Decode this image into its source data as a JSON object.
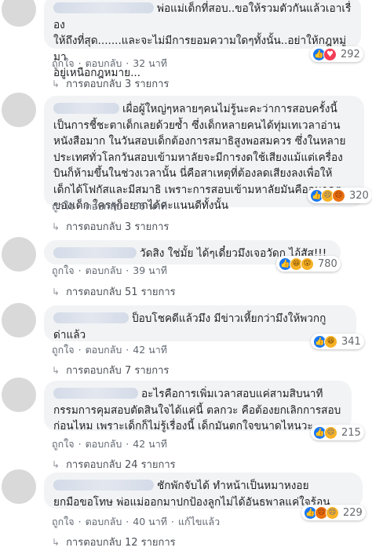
{
  "comments": [
    {
      "text": "พ่อแม่เด็กที่สอบ..ขอให้รวมตัวกันแล้วเอาเรื่อง\nให้ถึงที่สุด.......และจะไม่มีการยอมความใดๆทั้งนั้น..อย่าให้กฎหมู่มา\nอยู่เหนือกฎหมาย...",
      "reactions": [
        "like",
        "love"
      ],
      "reaction_count": "292",
      "like": "ถูกใจ",
      "reply": "ตอบกลับ",
      "time": "32 นาที",
      "replies": "การตอบกลับ 3 รายการ"
    },
    {
      "text": "เผื่อผู้ใหญ่ๆหลายๆคนไม่รู้นะคะว่าการสอบครั้งนี้\nเป็นการชี้ชะตาเด็กเลยด้วยซ้ำ ซึ่งเด็กหลายคนได้ทุ่มเทเวลาอ่าน\nหนังสือมาก ในวันสอบเด็กต้องการสมาธิสูงพอสมควร ซึ่งในหลาย\nประเทศทั่วโลกวันสอบเข้ามหาลัยจะมีการงดใช้เสียงแม้แต่เครื่อง\nบินก็ห้ามขึ้นในช่วงเวลานั้น นี่คือสาเหตุที่ต้องลดเสียงลงเพื่อให้\nเด็กได้โฟกัสและมีสมาธิ เพราะการสอบเข้ามหาลัยมันคืออนาคต\nของเด็ก ใครๆก็อยากได้คะแนนดีทั้งนั้น",
      "reactions": [
        "like",
        "sad",
        "angry"
      ],
      "reaction_count": "320",
      "like": "ถูกใจ",
      "reply": "ตอบกลับ",
      "time": "36 นาที",
      "replies": "การตอบกลับ 3 รายการ"
    },
    {
      "text": "วัดสิง ใช่มั้ย ได้ๆเดี๋ยวมึงเจอวัดกู ไอ้สัส!!!",
      "reactions": [
        "like",
        "haha",
        "wow"
      ],
      "reaction_count": "780",
      "like": "ถูกใจ",
      "reply": "ตอบกลับ",
      "time": "39 นาที",
      "replies": "การตอบกลับ 51 รายการ"
    },
    {
      "text": "ป็อบโชคดีแล้วมึง มีข่าวเหี้ยกว่ามึงให้พวกกู\nด่าแล้ว",
      "reactions": [
        "like",
        "haha"
      ],
      "reaction_count": "341",
      "like": "ถูกใจ",
      "reply": "ตอบกลับ",
      "time": "42 นาที",
      "replies": "การตอบกลับ 7 รายการ"
    },
    {
      "text": "อะไรคือการเพิ่มเวลาสอบแค่สามสิบนาที\nกรรมการคุมสอบตัดสินใจได้แค่นี้ ตลกวะ คือต้องยกเลิกการสอบ\nก่อนไหม เพราะเด็กก็ไม่รู้เรื่องนี้ เด็กมันตกใจขนาดไหนวะ",
      "reactions": [
        "like",
        "sad"
      ],
      "reaction_count": "215",
      "like": "ถูกใจ",
      "reply": "ตอบกลับ",
      "time": "42 นาที",
      "replies": "การตอบกลับ 24 รายการ"
    },
    {
      "text": "ชักพักจับได้ ทำหน้าเป็นหมาหงอย\nยกมือขอโทษ พ่อแม่ออกมาปกป้องลูกไม่ได้อันธพาลแค่ใจร้อน",
      "reactions": [
        "like",
        "angry",
        "sad"
      ],
      "reaction_count": "229",
      "like": "ถูกใจ",
      "reply": "ตอบกลับ",
      "time": "40 นาที",
      "edited": "แก้ไขแล้ว",
      "replies": "การตอบกลับ 12 รายการ"
    }
  ]
}
